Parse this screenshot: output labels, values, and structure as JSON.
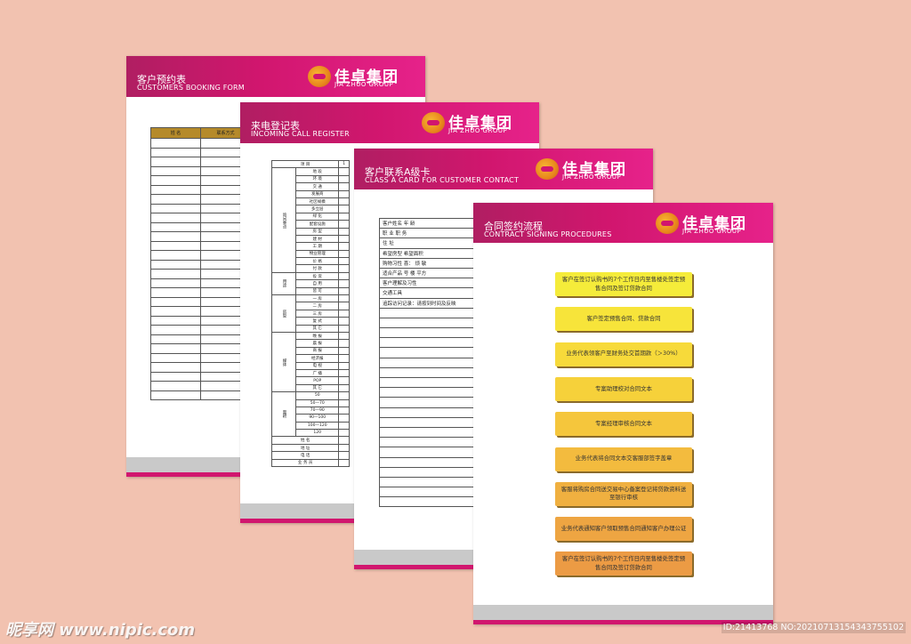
{
  "sheets": {
    "booking": {
      "title_cn": "客户预约表",
      "title_en": "CUSTOMERS BOOKING FORM",
      "col_headers": [
        "姓 名",
        "联系方式",
        ""
      ],
      "empty_rows": 28
    },
    "call_register": {
      "title_cn": "来电登记表",
      "title_en": "INCOMING CALL REGISTER",
      "header_item": "项   目",
      "header_num": "1",
      "groups": [
        {
          "label": "询问重点",
          "items": [
            "地 段",
            "环 境",
            "交 通",
            "发展商",
            "社区规模",
            "多立层",
            "绿 化",
            "配套设施",
            "房 型",
            "建 材",
            "工 期",
            "物业管理",
            "价 格",
            "付 款"
          ]
        },
        {
          "label": "用途",
          "items": [
            "投 资",
            "自 用",
            "皆 可"
          ]
        },
        {
          "label": "房型",
          "items": [
            "一 房",
            "二 房",
            "三 房",
            "复 式",
            "其 它"
          ]
        },
        {
          "label": "媒体",
          "items": [
            "晚 报",
            "晨 报",
            "商 报",
            "经济报",
            "电 视",
            "广 播",
            "POP",
            "其 它"
          ]
        },
        {
          "label": "面积",
          "items": [
            "50",
            "50—70",
            "70—90",
            "90—100",
            "100—120",
            "120"
          ]
        }
      ],
      "footer_items": [
        "姓 名",
        "地 址",
        "电 话",
        "业 务 员"
      ]
    },
    "a_card": {
      "title_cn": "客户联系A级卡",
      "title_en": "CLASS A CARD FOR CUSTOMER CONTACT",
      "rows": [
        "客户姓名                年  龄",
        "职    业                职  务",
        "住    址",
        "希望房型          希望面积",
        "购物习性  喜：    烦     敏",
        "适合产品      号     楼     平方",
        "客户理解及习性",
        "交通工具",
        "追踪访问记录：请按到时间及反映"
      ],
      "empty_rows": 20
    },
    "procedures": {
      "title_cn": "合同签约流程",
      "title_en": "CONTRACT SIGNING PROCEDURES",
      "steps": [
        "客户在签订认购书的7个工作日内至售楼处签定预售合同及签订贷款合同",
        "客户签定预售合同、贷款合同",
        "业务代表领客户至财务处交首期款（＞30%）",
        "专案助理校对合同文本",
        "专案经理审核合同文本",
        "业务代表将合同文本交客服部签字盖章",
        "客服将购房合同送交易中心备案登记将贷款资料送至银行审核",
        "业务代表通知客户领取预售合同通知客户办理公证",
        "客户在签订认购书的7个工作日内至售楼处签定预售合同及签订贷款合同"
      ],
      "step_colors": [
        "#f5ec3a",
        "#f7e43a",
        "#f7da3a",
        "#f6d13a",
        "#f5c63c",
        "#f3bb3e",
        "#f0b040",
        "#eea542",
        "#ec9b44"
      ]
    }
  },
  "logo": {
    "cn": "佳卓集团",
    "en": "JIA ZHUO GROUP"
  },
  "watermark": {
    "site": "昵享网 www.nipic.com",
    "id": "ID:21413768 NO:20210713154343755102"
  },
  "colors": {
    "background": "#f2c2b0",
    "header_magenta": "#d1166e",
    "footer_gray": "#c9c9c9"
  }
}
